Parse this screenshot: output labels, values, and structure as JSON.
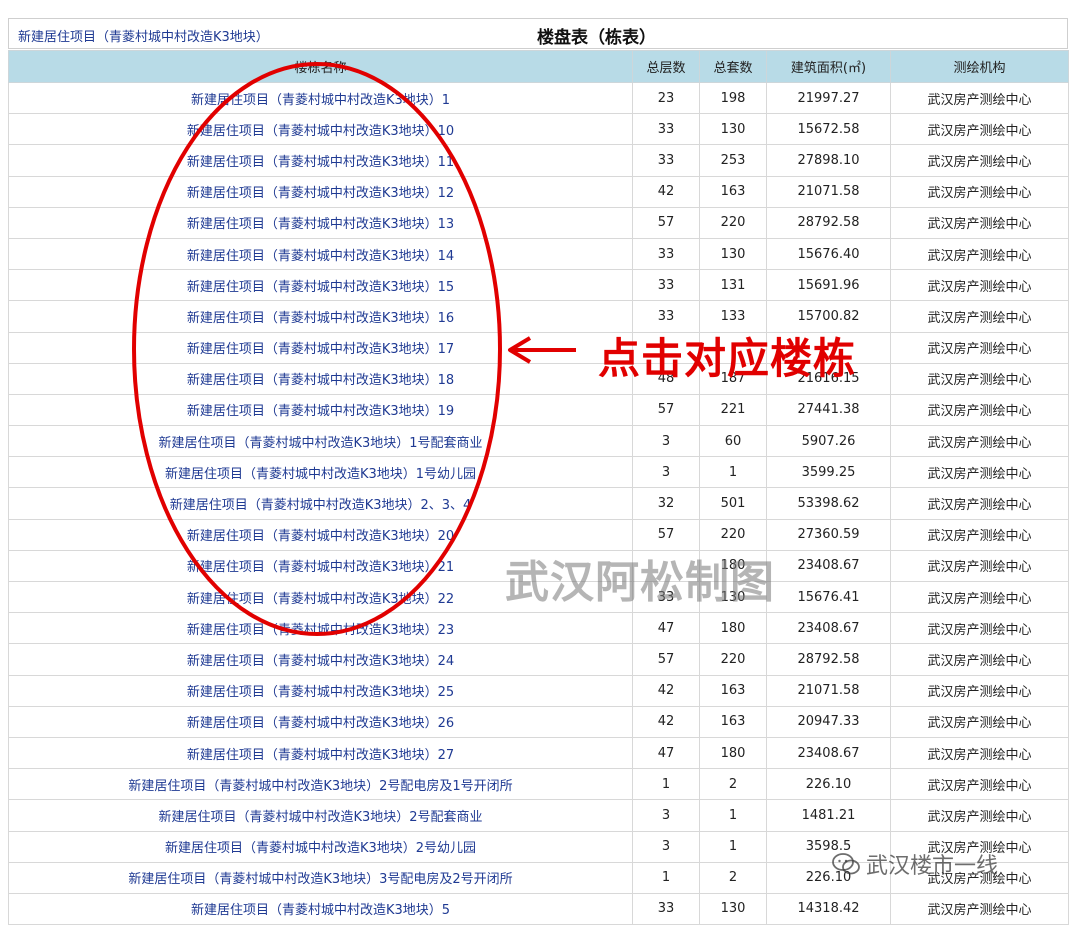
{
  "header": {
    "project_link": "新建居住项目（青菱村城中村改造K3地块）",
    "title": "楼盘表（栋表）"
  },
  "table": {
    "columns": [
      "楼栋名称",
      "总层数",
      "总套数",
      "建筑面积(㎡)",
      "测绘机构"
    ],
    "rows": [
      {
        "name": "新建居住项目（青菱村城中村改造K3地块）1",
        "floors": "23",
        "units": "198",
        "area": "21997.27",
        "org": "武汉房产测绘中心"
      },
      {
        "name": "新建居住项目（青菱村城中村改造K3地块）10",
        "floors": "33",
        "units": "130",
        "area": "15672.58",
        "org": "武汉房产测绘中心"
      },
      {
        "name": "新建居住项目（青菱村城中村改造K3地块）11",
        "floors": "33",
        "units": "253",
        "area": "27898.10",
        "org": "武汉房产测绘中心"
      },
      {
        "name": "新建居住项目（青菱村城中村改造K3地块）12",
        "floors": "42",
        "units": "163",
        "area": "21071.58",
        "org": "武汉房产测绘中心"
      },
      {
        "name": "新建居住项目（青菱村城中村改造K3地块）13",
        "floors": "57",
        "units": "220",
        "area": "28792.58",
        "org": "武汉房产测绘中心"
      },
      {
        "name": "新建居住项目（青菱村城中村改造K3地块）14",
        "floors": "33",
        "units": "130",
        "area": "15676.40",
        "org": "武汉房产测绘中心"
      },
      {
        "name": "新建居住项目（青菱村城中村改造K3地块）15",
        "floors": "33",
        "units": "131",
        "area": "15691.96",
        "org": "武汉房产测绘中心"
      },
      {
        "name": "新建居住项目（青菱村城中村改造K3地块）16",
        "floors": "33",
        "units": "133",
        "area": "15700.82",
        "org": "武汉房产测绘中心"
      },
      {
        "name": "新建居住项目（青菱村城中村改造K3地块）17",
        "floors": "",
        "units": "",
        "area": "",
        "org": "武汉房产测绘中心"
      },
      {
        "name": "新建居住项目（青菱村城中村改造K3地块）18",
        "floors": "48",
        "units": "187",
        "area": "21616.15",
        "org": "武汉房产测绘中心"
      },
      {
        "name": "新建居住项目（青菱村城中村改造K3地块）19",
        "floors": "57",
        "units": "221",
        "area": "27441.38",
        "org": "武汉房产测绘中心"
      },
      {
        "name": "新建居住项目（青菱村城中村改造K3地块）1号配套商业",
        "floors": "3",
        "units": "60",
        "area": "5907.26",
        "org": "武汉房产测绘中心"
      },
      {
        "name": "新建居住项目（青菱村城中村改造K3地块）1号幼儿园",
        "floors": "3",
        "units": "1",
        "area": "3599.25",
        "org": "武汉房产测绘中心"
      },
      {
        "name": "新建居住项目（青菱村城中村改造K3地块）2、3、4",
        "floors": "32",
        "units": "501",
        "area": "53398.62",
        "org": "武汉房产测绘中心"
      },
      {
        "name": "新建居住项目（青菱村城中村改造K3地块）20",
        "floors": "57",
        "units": "220",
        "area": "27360.59",
        "org": "武汉房产测绘中心"
      },
      {
        "name": "新建居住项目（青菱村城中村改造K3地块）21",
        "floors": "",
        "units": "180",
        "area": "23408.67",
        "org": "武汉房产测绘中心"
      },
      {
        "name": "新建居住项目（青菱村城中村改造K3地块）22",
        "floors": "33",
        "units": "130",
        "area": "15676.41",
        "org": "武汉房产测绘中心"
      },
      {
        "name": "新建居住项目（青菱村城中村改造K3地块）23",
        "floors": "47",
        "units": "180",
        "area": "23408.67",
        "org": "武汉房产测绘中心"
      },
      {
        "name": "新建居住项目（青菱村城中村改造K3地块）24",
        "floors": "57",
        "units": "220",
        "area": "28792.58",
        "org": "武汉房产测绘中心"
      },
      {
        "name": "新建居住项目（青菱村城中村改造K3地块）25",
        "floors": "42",
        "units": "163",
        "area": "21071.58",
        "org": "武汉房产测绘中心"
      },
      {
        "name": "新建居住项目（青菱村城中村改造K3地块）26",
        "floors": "42",
        "units": "163",
        "area": "20947.33",
        "org": "武汉房产测绘中心"
      },
      {
        "name": "新建居住项目（青菱村城中村改造K3地块）27",
        "floors": "47",
        "units": "180",
        "area": "23408.67",
        "org": "武汉房产测绘中心"
      },
      {
        "name": "新建居住项目（青菱村城中村改造K3地块）2号配电房及1号开闭所",
        "floors": "1",
        "units": "2",
        "area": "226.10",
        "org": "武汉房产测绘中心"
      },
      {
        "name": "新建居住项目（青菱村城中村改造K3地块）2号配套商业",
        "floors": "3",
        "units": "1",
        "area": "1481.21",
        "org": "武汉房产测绘中心"
      },
      {
        "name": "新建居住项目（青菱村城中村改造K3地块）2号幼儿园",
        "floors": "3",
        "units": "1",
        "area": "3598.5",
        "org": "武汉房产测绘中心"
      },
      {
        "name": "新建居住项目（青菱村城中村改造K3地块）3号配电房及2号开闭所",
        "floors": "1",
        "units": "2",
        "area": "226.10",
        "org": "武汉房产测绘中心"
      },
      {
        "name": "新建居住项目（青菱村城中村改造K3地块）5",
        "floors": "33",
        "units": "130",
        "area": "14318.42",
        "org": "武汉房产测绘中心"
      }
    ]
  },
  "overlay": {
    "annotation_text": "点击对应楼栋",
    "arrow_icon": "left-arrow-icon",
    "annotation_color": "#e10000",
    "watermark_text": "武汉阿松制图",
    "wechat_text": "武汉楼市一线",
    "wechat_icon": "wechat-icon"
  },
  "colors": {
    "header_bg": "#b8dbe7",
    "link": "#1f3a93",
    "ellipse": "#e10000"
  }
}
